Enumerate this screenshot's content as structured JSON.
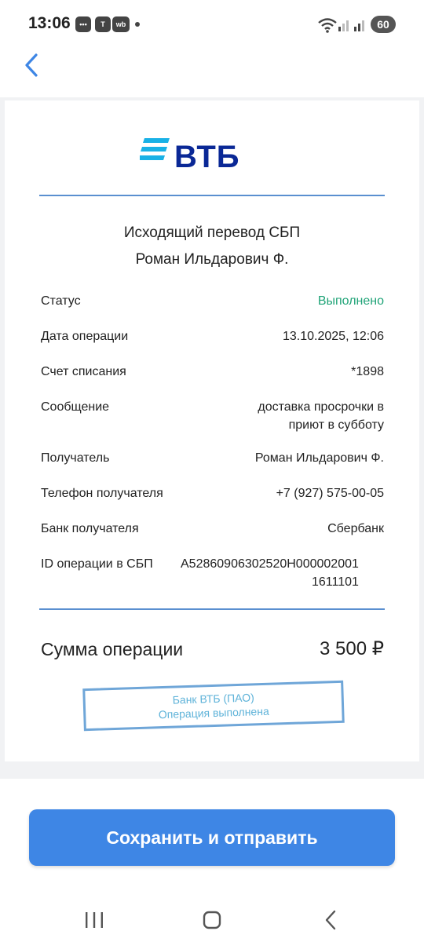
{
  "status_bar": {
    "time": "13:06",
    "notifications": [
      {
        "icon": "chat-bubble-icon",
        "glyph": "•••"
      },
      {
        "icon": "t-app-icon",
        "glyph": "T"
      },
      {
        "icon": "wb-app-icon",
        "glyph": "wb"
      }
    ],
    "battery": "60"
  },
  "receipt": {
    "bank_name": "ВТБ",
    "accent_color": "#0a2896",
    "title": "Исходящий перевод СБП",
    "recipient_heading": "Роман Ильдарович Ф.",
    "rows": [
      {
        "label": "Статус",
        "value": "Выполнено"
      },
      {
        "label": "Дата операции",
        "value": "13.10.2025, 12:06"
      },
      {
        "label": "Счет списания",
        "value": "*1898"
      },
      {
        "label": "Сообщение",
        "value_lines": [
          "доставка просрочки в",
          "приют в субботу"
        ]
      },
      {
        "label": "Получатель",
        "value": "Роман Ильдарович Ф."
      },
      {
        "label": "Телефон получателя",
        "value": "+7 (927) 575-00-05"
      },
      {
        "label": "Банк получателя",
        "value": "Сбербанк"
      },
      {
        "label": "ID операции в СБП",
        "value_lines": [
          "A52860906302520H000002001",
          "1611101"
        ]
      }
    ],
    "sum_label": "Сумма операции",
    "sum_value": "3 500 ₽",
    "stamp_lines": [
      "Банк ВТБ (ПАО)",
      "Операция выполнена"
    ]
  },
  "actions": {
    "save_send_label": "Сохранить и отправить"
  },
  "colors": {
    "status_success": "#1fa377",
    "primary_button": "#3e86e5",
    "divider": "#5a8fd0"
  }
}
